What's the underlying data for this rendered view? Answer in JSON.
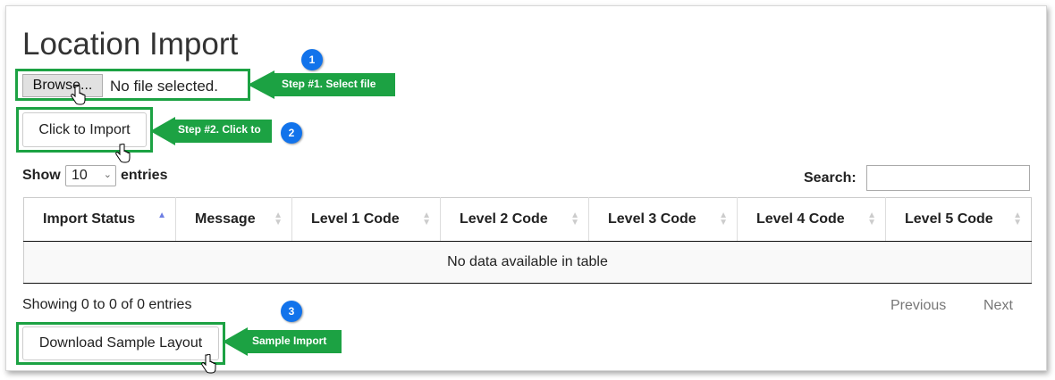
{
  "page": {
    "title": "Location Import",
    "file_input": {
      "button_label": "Browse...",
      "status_text": "No file selected."
    },
    "import_button_label": "Click to Import",
    "download_button_label": "Download Sample Layout"
  },
  "callouts": [
    {
      "badge": "1",
      "text": "Step #1. Select file"
    },
    {
      "badge": "2",
      "text": "Step #2. Click to"
    },
    {
      "badge": "3",
      "text": "Sample Import"
    }
  ],
  "table_controls": {
    "show_label": "Show",
    "entries_value": "10",
    "entries_label": "entries",
    "search_label": "Search:",
    "search_value": ""
  },
  "table": {
    "columns": [
      "Import Status",
      "Message",
      "Level 1 Code",
      "Level 2 Code",
      "Level 3 Code",
      "Level 4 Code",
      "Level 5 Code"
    ],
    "empty_message": "No data available in table"
  },
  "footer": {
    "info": "Showing 0 to 0 of 0 entries",
    "previous_label": "Previous",
    "next_label": "Next"
  },
  "colors": {
    "highlight": "#1ca243",
    "badge": "#1273eb",
    "arrow": "#1ca243"
  }
}
